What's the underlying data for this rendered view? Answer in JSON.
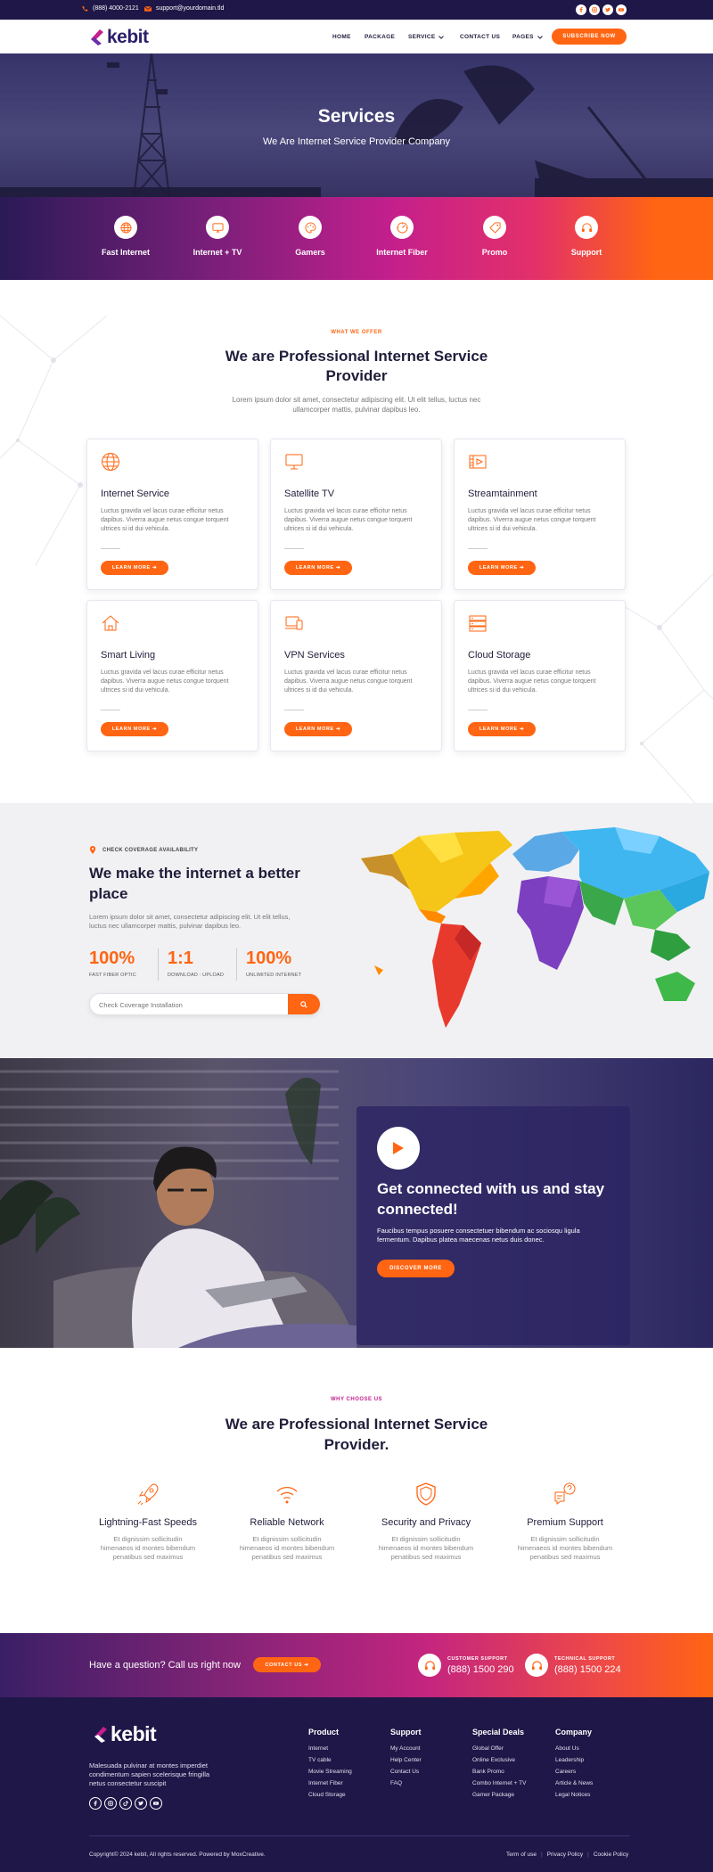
{
  "topbar": {
    "phone": "(888) 4000-2121",
    "email": "support@yourdomain.tld"
  },
  "brand": {
    "name": "kebit"
  },
  "nav": {
    "items": [
      "HOME",
      "PACKAGE",
      "SERVICE",
      "CONTACT US",
      "PAGES"
    ],
    "cta": "SUBSCRIBE NOW"
  },
  "hero": {
    "title": "Services",
    "subtitle": "We Are Internet Service Provider Company"
  },
  "features": [
    "Fast Internet",
    "Internet + TV",
    "Gamers",
    "Internet Fiber",
    "Promo",
    "Support"
  ],
  "offer": {
    "eyebrow": "WHAT WE OFFER",
    "title_line1": "We are Professional Internet Service",
    "title_line2": "Provider",
    "lead_line1": "Lorem ipsum dolor sit amet, consectetur adipiscing elit. Ut elit tellus, luctus nec",
    "lead_line2": "ullamcorper mattis, pulvinar dapibus leo.",
    "cards": [
      {
        "icon": "globe-icon",
        "title": "Internet Service",
        "desc": "Luctus gravida vel lacus curae efficitur netus dapibus. Viverra augue netus congue torquent ultrices si id dui vehicula.",
        "button": "LEARN MORE"
      },
      {
        "icon": "monitor-icon",
        "title": "Satellite TV",
        "desc": "Luctus gravida vel lacus curae efficitur netus dapibus. Viverra augue netus congue torquent ultrices si id dui vehicula.",
        "button": "LEARN MORE"
      },
      {
        "icon": "film-icon",
        "title": "Streamtainment",
        "desc": "Luctus gravida vel lacus curae efficitur netus dapibus. Viverra augue netus congue torquent ultrices si id dui vehicula.",
        "button": "LEARN MORE"
      },
      {
        "icon": "home-icon",
        "title": "Smart Living",
        "desc": "Luctus gravida vel lacus curae efficitur netus dapibus. Viverra augue netus congue torquent ultrices si id dui vehicula.",
        "button": "LEARN MORE"
      },
      {
        "icon": "devices-icon",
        "title": "VPN Services",
        "desc": "Luctus gravida vel lacus curae efficitur netus dapibus. Viverra augue netus congue torquent ultrices si id dui vehicula.",
        "button": "LEARN MORE"
      },
      {
        "icon": "server-icon",
        "title": "Cloud Storage",
        "desc": "Luctus gravida vel lacus curae efficitur netus dapibus. Viverra augue netus congue torquent ultrices si id dui vehicula.",
        "button": "LEARN MORE"
      }
    ]
  },
  "coverage": {
    "eyebrow": "CHECK COVERAGE AVAILABILITY",
    "title_line1": "We make the internet a better",
    "title_line2": "place",
    "desc_line1": "Lorem ipsum dolor sit amet, consectetur adipiscing elit. Ut elit tellus,",
    "desc_line2": "luctus nec ullamcorper mattis, pulvinar dapibus leo.",
    "stats": [
      {
        "value": "100%",
        "label": "FAST FIBER OPTIC"
      },
      {
        "value": "1:1",
        "label": "DOWNLOAD : UPLOAD"
      },
      {
        "value": "100%",
        "label": "UNLIMITED INTERNET"
      }
    ],
    "search_placeholder": "Check Coverage Installation"
  },
  "video": {
    "title_line1": "Get connected with us and stay",
    "title_line2": "connected!",
    "desc_line1": "Faucibus tempus posuere consectetuer bibendum ac sociosqu ligula",
    "desc_line2": "fermentum. Dapibus platea maecenas netus duis donec.",
    "button": "DISCOVER MORE"
  },
  "why": {
    "eyebrow": "WHY CHOOSE US",
    "title_line1": "We are Professional Internet Service",
    "title_line2": "Provider.",
    "items": [
      {
        "icon": "rocket-icon",
        "title": "Lightning-Fast Speeds",
        "desc_line1": "Et dignissim sollicitudin",
        "desc_line2": "himenaeos id montes bibendum",
        "desc_line3": "penatibus sed maximus"
      },
      {
        "icon": "wifi-icon",
        "title": "Reliable Network",
        "desc_line1": "Et dignissim sollicitudin",
        "desc_line2": "himenaeos id montes bibendum",
        "desc_line3": "penatibus sed maximus"
      },
      {
        "icon": "shield-icon",
        "title": "Security and Privacy",
        "desc_line1": "Et dignissim sollicitudin",
        "desc_line2": "himenaeos id montes bibendum",
        "desc_line3": "penatibus sed maximus"
      },
      {
        "icon": "chat-question-icon",
        "title": "Premium Support",
        "desc_line1": "Et dignissim sollicitudin",
        "desc_line2": "himenaeos id montes bibendum",
        "desc_line3": "penatibus sed maximus"
      }
    ]
  },
  "cta": {
    "question": "Have a question? Call us right now",
    "button": "CONTACT US",
    "customer_label": "CUSTOMER SUPPORT",
    "customer_phone": "(888) 1500 290",
    "technical_label": "TECHNICAL SUPPORT",
    "technical_phone": "(888) 1500 224"
  },
  "footer": {
    "about_line1": "Malesuada pulvinar at montes imperdiet",
    "about_line2": "condimentum sapien scelerisque fringilla",
    "about_line3": "netus consectetur suscipit",
    "columns": [
      {
        "title": "Product",
        "links": [
          "Internet",
          "TV cable",
          "Movie Streaming",
          "Internet Fiber",
          "Cloud Storage"
        ]
      },
      {
        "title": "Support",
        "links": [
          "My Account",
          "Help Center",
          "Contact Us",
          "FAQ"
        ]
      },
      {
        "title": "Special Deals",
        "links": [
          "Global Offer",
          "Online Exclusive",
          "Bank Promo",
          "Combo Internet + TV",
          "Gamer Package"
        ]
      },
      {
        "title": "Company",
        "links": [
          "About Us",
          "Leadership",
          "Careers",
          "Article & News",
          "Legal Notices"
        ]
      }
    ],
    "copyright": "Copyright© 2024 kebit, All rights reserved. Powered by MoxCreative.",
    "legal_links": [
      "Term of use",
      "Privacy Policy",
      "Cookie Policy"
    ]
  },
  "colors": {
    "accent": "#ff6512",
    "navy": "#1f1747",
    "magenta": "#c41f8c"
  }
}
